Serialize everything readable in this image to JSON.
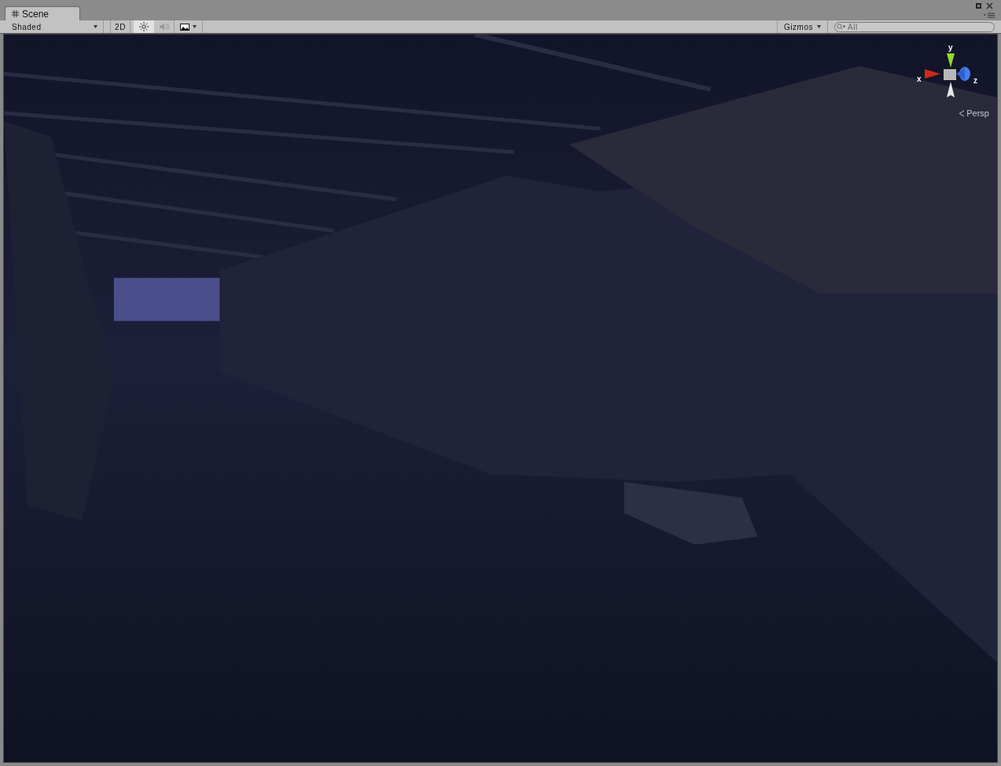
{
  "tabs": [
    {
      "label": "Scene",
      "selected": true
    }
  ],
  "toolbar": {
    "draw_mode": "Shaded",
    "mode_2d": {
      "label": "2D",
      "on": false
    },
    "lighting": {
      "on": true
    },
    "audio": {
      "on": false
    },
    "gizmos": "Gizmos",
    "search": {
      "placeholder": "All"
    }
  },
  "orientation_gizmo": {
    "axes": [
      {
        "kind": "x",
        "label": "x"
      },
      {
        "kind": "y",
        "label": "y"
      },
      {
        "kind": "z",
        "label": "z"
      }
    ],
    "projection": "Persp"
  }
}
